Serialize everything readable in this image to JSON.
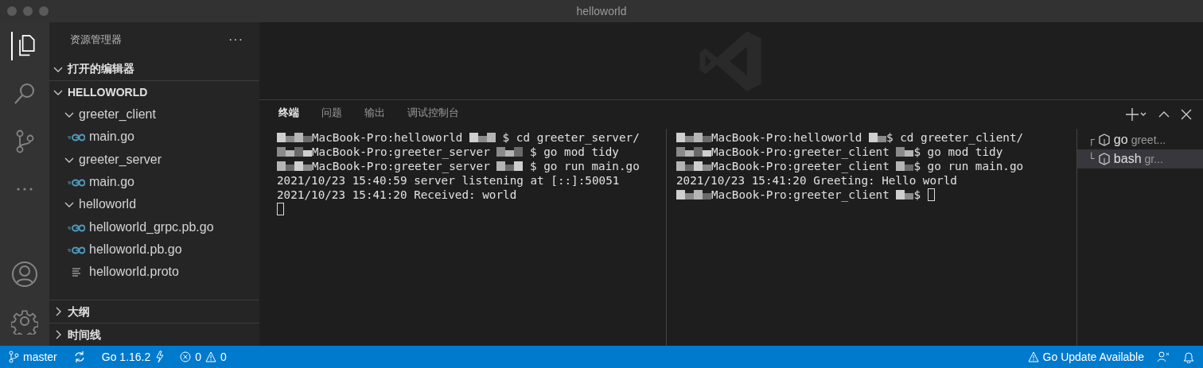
{
  "window": {
    "title": "helloworld"
  },
  "activity_bar": [
    {
      "kind": "files",
      "selected": true
    },
    {
      "kind": "search",
      "selected": false
    },
    {
      "kind": "scm",
      "selected": false
    },
    {
      "kind": "more",
      "selected": false
    }
  ],
  "sidebar": {
    "title": "资源管理器",
    "more": "···",
    "sections": [
      {
        "label": "打开的编辑器",
        "expanded": true
      },
      {
        "label": "HELLOWORLD",
        "expanded": true,
        "tree": [
          {
            "label": "greeter_client",
            "kind": "folder",
            "expanded": true,
            "children": [
              {
                "label": "main.go",
                "kind": "go"
              }
            ]
          },
          {
            "label": "greeter_server",
            "kind": "folder",
            "expanded": true,
            "children": [
              {
                "label": "main.go",
                "kind": "go"
              }
            ]
          },
          {
            "label": "helloworld",
            "kind": "folder",
            "expanded": true,
            "children": [
              {
                "label": "helloworld_grpc.pb.go",
                "kind": "go"
              },
              {
                "label": "helloworld.pb.go",
                "kind": "go"
              },
              {
                "label": "helloworld.proto",
                "kind": "text"
              }
            ]
          }
        ]
      }
    ],
    "bottom_sections": [
      {
        "label": "大纲",
        "expanded": false
      },
      {
        "label": "时间线",
        "expanded": false
      }
    ]
  },
  "panel": {
    "tabs": [
      {
        "label": "终端",
        "selected": true
      },
      {
        "label": "问题",
        "selected": false
      },
      {
        "label": "输出",
        "selected": false
      },
      {
        "label": "调试控制台",
        "selected": false
      }
    ],
    "terminals": [
      {
        "lines": [
          [
            {
              "kind": "redacted"
            },
            {
              "kind": "text",
              "text": "MacBook-Pro:helloworld "
            },
            {
              "kind": "redacted"
            },
            {
              "kind": "text",
              "text": " $ cd greeter_server/"
            }
          ],
          [
            {
              "kind": "redacted"
            },
            {
              "kind": "text",
              "text": "MacBook-Pro:greeter_server "
            },
            {
              "kind": "redacted"
            },
            {
              "kind": "text",
              "text": " $ go mod tidy"
            }
          ],
          [
            {
              "kind": "redacted"
            },
            {
              "kind": "text",
              "text": "MacBook-Pro:greeter_server "
            },
            {
              "kind": "redacted"
            },
            {
              "kind": "text",
              "text": " $ go run main.go"
            }
          ],
          [
            {
              "kind": "text",
              "text": "2021/10/23 15:40:59 server listening at [::]:50051"
            }
          ],
          [
            {
              "kind": "text",
              "text": "2021/10/23 15:41:20 Received: world"
            }
          ],
          [
            {
              "kind": "cursor"
            }
          ]
        ]
      },
      {
        "lines": [
          [
            {
              "kind": "redacted"
            },
            {
              "kind": "text",
              "text": "MacBook-Pro:helloworld "
            },
            {
              "kind": "redacted"
            },
            {
              "kind": "text",
              "text": "$ cd greeter_client/"
            }
          ],
          [
            {
              "kind": "redacted"
            },
            {
              "kind": "text",
              "text": "MacBook-Pro:greeter_client "
            },
            {
              "kind": "redacted"
            },
            {
              "kind": "text",
              "text": "$ go mod tidy"
            }
          ],
          [
            {
              "kind": "redacted"
            },
            {
              "kind": "text",
              "text": "MacBook-Pro:greeter_client "
            },
            {
              "kind": "redacted"
            },
            {
              "kind": "text",
              "text": "$ go run main.go"
            }
          ],
          [
            {
              "kind": "text",
              "text": "2021/10/23 15:41:20 Greeting: Hello world"
            }
          ],
          [
            {
              "kind": "redacted"
            },
            {
              "kind": "text",
              "text": "MacBook-Pro:greeter_client "
            },
            {
              "kind": "redacted"
            },
            {
              "kind": "text",
              "text": "$ "
            },
            {
              "kind": "cursor"
            }
          ]
        ]
      }
    ],
    "terminal_list": [
      {
        "tree": "┌",
        "name": "go",
        "detail": "greet...",
        "selected": false
      },
      {
        "tree": "└",
        "name": "bash",
        "detail": "gr...",
        "selected": true
      }
    ]
  },
  "status_bar": {
    "branch": "master",
    "go_version": "Go 1.16.2",
    "errors": "0",
    "warnings": "0",
    "update": "Go Update Available"
  }
}
